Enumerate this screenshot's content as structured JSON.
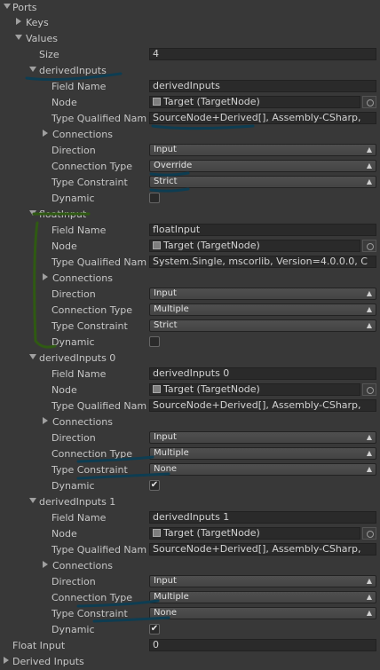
{
  "ports": {
    "label": "Ports",
    "keys_label": "Keys",
    "values_label": "Values",
    "size_label": "Size",
    "size_value": "4",
    "items": [
      {
        "header": "derivedInputs",
        "field_name": "derivedInputs",
        "node": "Target (TargetNode)",
        "type_qualified": "SourceNode+Derived[], Assembly-CSharp,",
        "direction": "Input",
        "connection_type": "Override",
        "type_constraint": "Strict",
        "dynamic": ""
      },
      {
        "header": "floatInput",
        "field_name": "floatInput",
        "node": "Target (TargetNode)",
        "type_qualified": "System.Single, mscorlib, Version=4.0.0.0, C",
        "direction": "Input",
        "connection_type": "Multiple",
        "type_constraint": "Strict",
        "dynamic": ""
      },
      {
        "header": "derivedInputs 0",
        "field_name": "derivedInputs 0",
        "node": "Target (TargetNode)",
        "type_qualified": "SourceNode+Derived[], Assembly-CSharp,",
        "direction": "Input",
        "connection_type": "Multiple",
        "type_constraint": "None",
        "dynamic": "✔"
      },
      {
        "header": "derivedInputs 1",
        "field_name": "derivedInputs 1",
        "node": "Target (TargetNode)",
        "type_qualified": "SourceNode+Derived[], Assembly-CSharp,",
        "direction": "Input",
        "connection_type": "Multiple",
        "type_constraint": "None",
        "dynamic": "✔"
      }
    ]
  },
  "labels": {
    "field_name": "Field Name",
    "node": "Node",
    "type_qualified": "Type Qualified Nam",
    "connections": "Connections",
    "direction": "Direction",
    "connection_type": "Connection Type",
    "type_constraint": "Type Constraint",
    "dynamic": "Dynamic"
  },
  "float_input": {
    "label": "Float Input",
    "value": "0"
  },
  "derived_inputs_label": "Derived Inputs",
  "icons": {
    "foldout_open": "triangle-down-icon",
    "foldout_closed": "triangle-right-icon",
    "object": "scriptable-object-icon",
    "object_picker": "object-picker-icon",
    "dropdown_arrow": "dropdown-arrow-icon",
    "checkmark": "checkmark-icon"
  },
  "annotation_color": "#0d3d52",
  "annotation_bracket_color": "#2f5a12"
}
